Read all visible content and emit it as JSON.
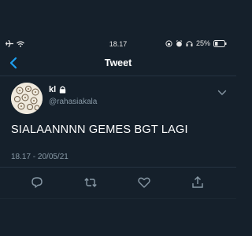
{
  "status_bar": {
    "time": "18.17",
    "battery": "25%"
  },
  "header": {
    "title": "Tweet"
  },
  "tweet": {
    "display_name": "kl",
    "handle": "@rahasiakala",
    "text": "SIALAANNNN GEMES BGT LAGI",
    "timestamp": "18.17 - 20/05/21"
  },
  "icons": {
    "status_left": [
      "airplane-icon",
      "wifi-icon"
    ],
    "status_right": [
      "lock-rotation-icon",
      "alarm-icon",
      "headphones-icon",
      "battery-icon"
    ],
    "back": "chevron-left-icon",
    "protected": "lock-icon",
    "more": "chevron-down-icon",
    "actions": [
      "reply-icon",
      "retweet-icon",
      "like-icon",
      "share-icon"
    ]
  },
  "colors": {
    "background": "#15202b",
    "accent": "#1da1f2",
    "muted": "#8899a6",
    "divider": "#253341"
  }
}
